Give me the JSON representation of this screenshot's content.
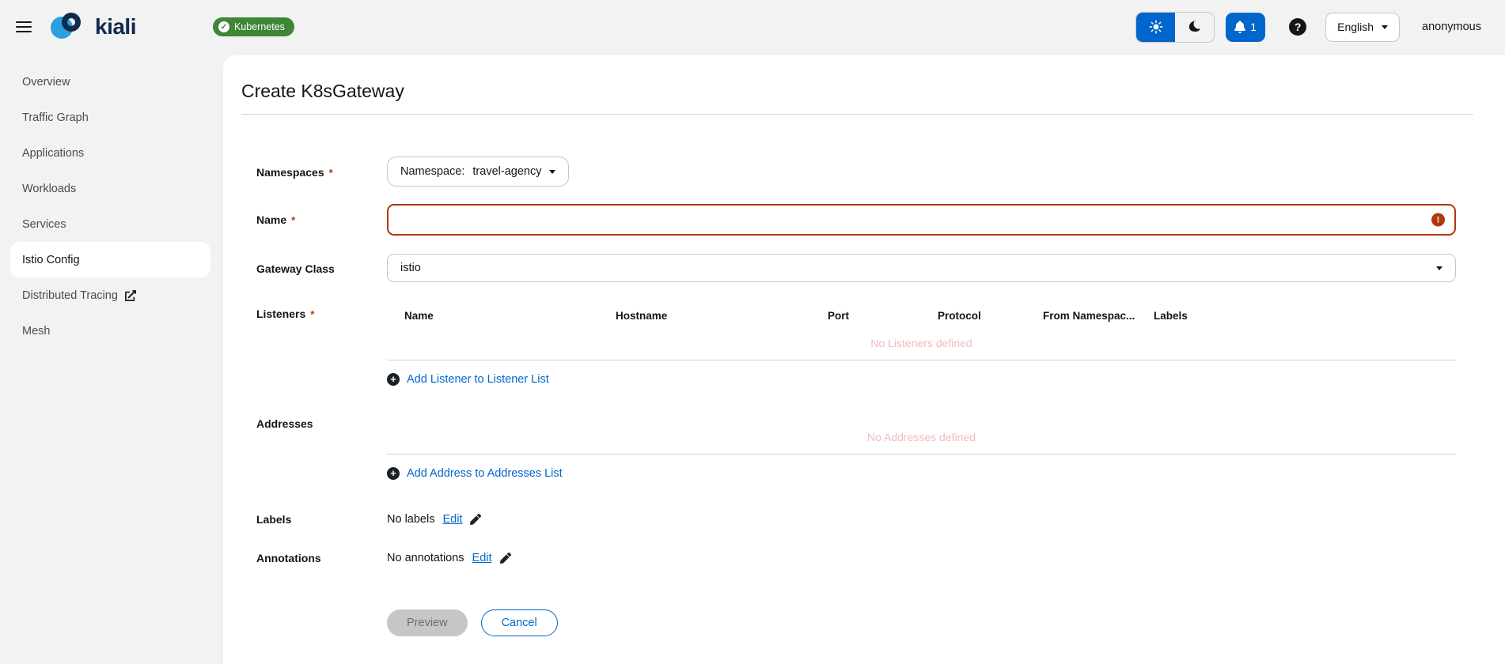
{
  "masthead": {
    "brand": "kiali",
    "cluster_badge": "Kubernetes",
    "notifications_count": "1",
    "language": "English",
    "user": "anonymous",
    "help_glyph": "?"
  },
  "sidebar": {
    "items": [
      {
        "label": "Overview",
        "active": false
      },
      {
        "label": "Traffic Graph",
        "active": false
      },
      {
        "label": "Applications",
        "active": false
      },
      {
        "label": "Workloads",
        "active": false
      },
      {
        "label": "Services",
        "active": false
      },
      {
        "label": "Istio Config",
        "active": true
      },
      {
        "label": "Distributed Tracing",
        "active": false,
        "external": true
      },
      {
        "label": "Mesh",
        "active": false
      }
    ]
  },
  "page": {
    "title": "Create K8sGateway"
  },
  "form": {
    "namespaces": {
      "label": "Namespaces",
      "required": "*",
      "toggle_prefix": "Namespace:",
      "value": "travel-agency"
    },
    "name": {
      "label": "Name",
      "required": "*",
      "value": "",
      "error": true
    },
    "gateway_class": {
      "label": "Gateway Class",
      "value": "istio"
    },
    "listeners": {
      "label": "Listeners",
      "required": "*",
      "columns": [
        "Name",
        "Hostname",
        "Port",
        "Protocol",
        "From Namespac...",
        "Labels"
      ],
      "empty_text": "No Listeners defined",
      "add_label": "Add Listener to Listener List"
    },
    "addresses": {
      "label": "Addresses",
      "empty_text": "No Addresses defined",
      "add_label": "Add Address to Addresses List"
    },
    "labels_row": {
      "label": "Labels",
      "empty_text": "No labels",
      "edit_label": "Edit"
    },
    "annotations_row": {
      "label": "Annotations",
      "empty_text": "No annotations",
      "edit_label": "Edit"
    },
    "actions": {
      "preview": "Preview",
      "cancel": "Cancel"
    }
  },
  "colors": {
    "accent_blue": "#0066cc",
    "danger": "#b1380b",
    "badge_green": "#3e8635",
    "brand_navy": "#0e2b4d",
    "brand_blue": "#2b9fe0",
    "empty_state_pink": "#f1bcbc"
  }
}
